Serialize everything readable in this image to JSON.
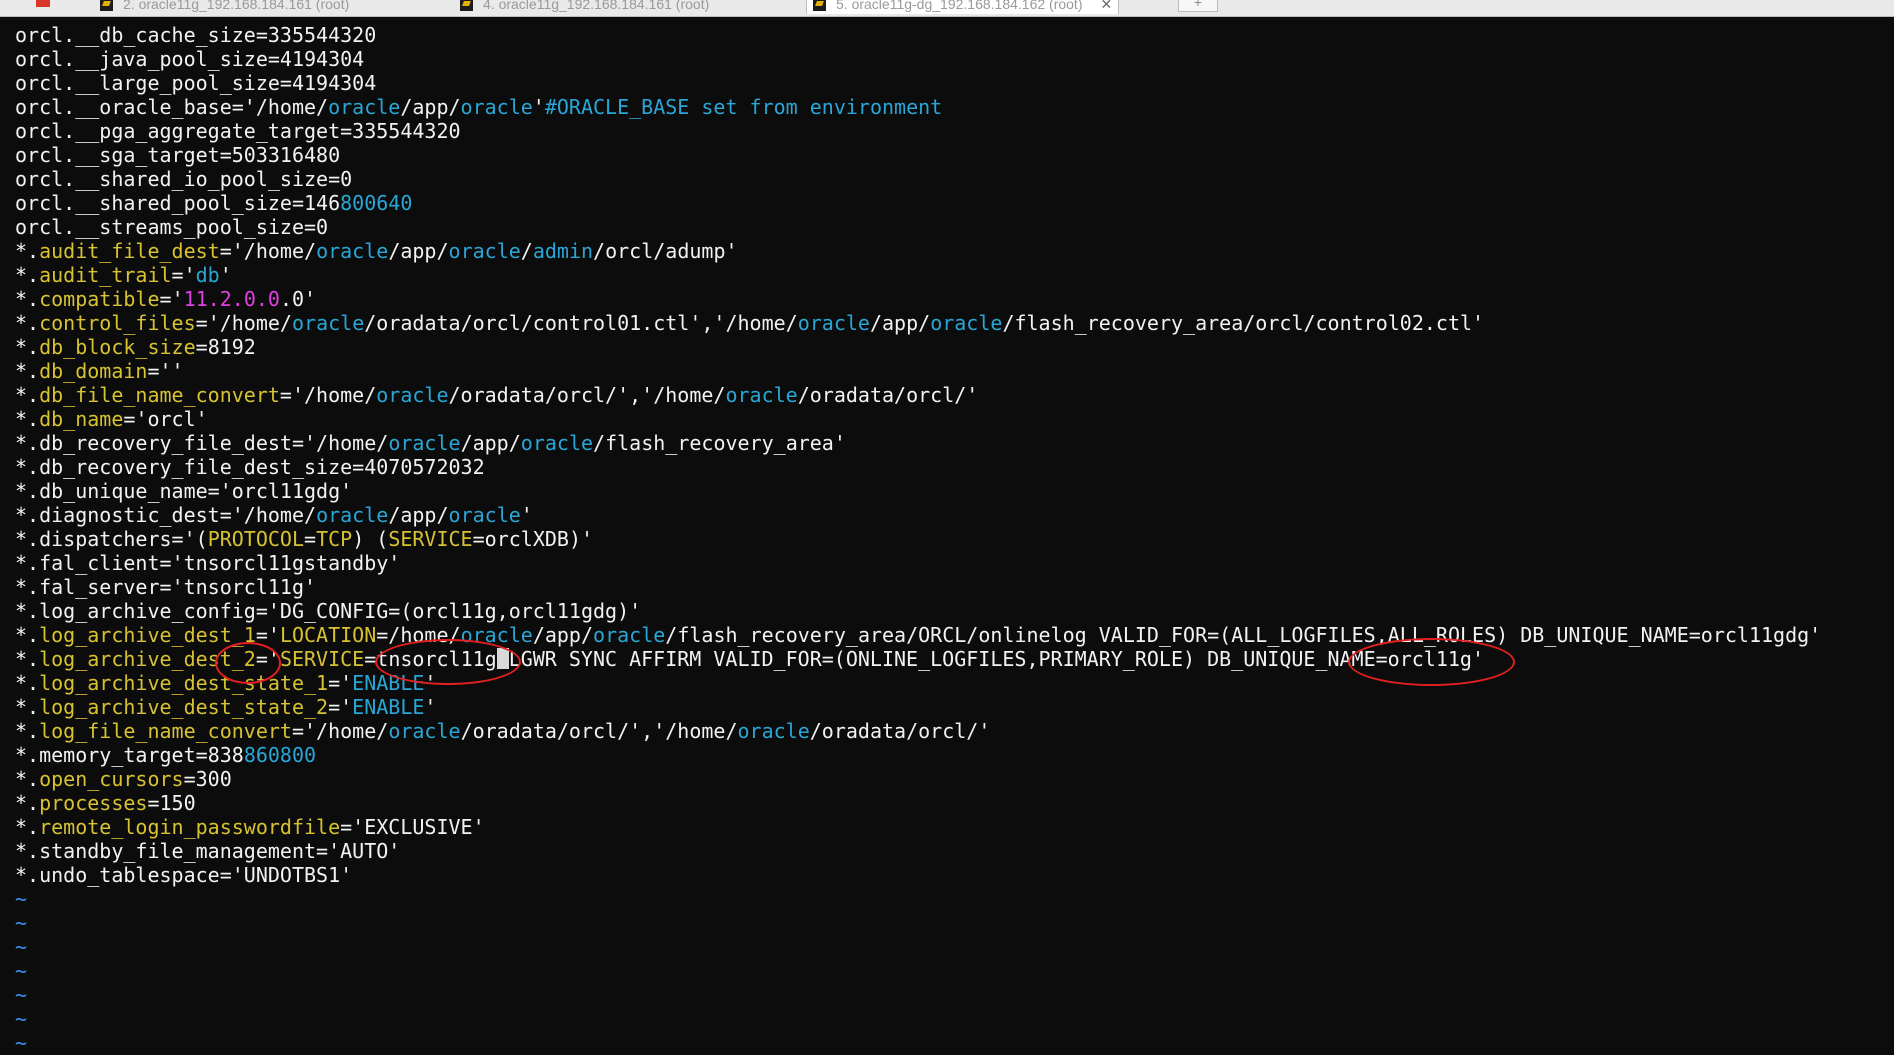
{
  "tabs": [
    {
      "label": "2. oracle11g_192.168.184.161 (root)"
    },
    {
      "label": "4. oracle11g_192.168.184.161 (root)"
    },
    {
      "label": "5. oracle11g-dg_192.168.184.162 (root)"
    }
  ],
  "tab_close": "✕",
  "new_tab": "+",
  "editor": {
    "lines": [
      "orcl.__db_cache_size=335544320",
      "orcl.__java_pool_size=4194304",
      "orcl.__large_pool_size=4194304",
      "orcl.__oracle_base='/home/oracle/app/oracle'#ORACLE_BASE set from environment",
      "orcl.__pga_aggregate_target=335544320",
      "orcl.__sga_target=503316480",
      "orcl.__shared_io_pool_size=0",
      "orcl.__shared_pool_size=146800640",
      "orcl.__streams_pool_size=0",
      "*.audit_file_dest='/home/oracle/app/oracle/admin/orcl/adump'",
      "*.audit_trail='db'",
      "*.compatible='11.2.0.0.0'",
      "*.control_files='/home/oracle/oradata/orcl/control01.ctl','/home/oracle/app/oracle/flash_recovery_area/orcl/control02.ctl'",
      "*.db_block_size=8192",
      "*.db_domain=''",
      "*.db_file_name_convert='/home/oracle/oradata/orcl/','/home/oracle/oradata/orcl/'",
      "*.db_name='orcl'",
      "*.db_recovery_file_dest='/home/oracle/app/oracle/flash_recovery_area'",
      "*.db_recovery_file_dest_size=4070572032",
      "*.db_unique_name='orcl11gdg'",
      "*.diagnostic_dest='/home/oracle/app/oracle'",
      "*.dispatchers='(PROTOCOL=TCP) (SERVICE=orclXDB)'",
      "*.fal_client='tnsorcl11gstandby'",
      "*.fal_server='tnsorcl11g'",
      "*.log_archive_config='DG_CONFIG=(orcl11g,orcl11gdg)'",
      "*.log_archive_dest_1='LOCATION=/home/oracle/app/oracle/flash_recovery_area/ORCL/onlinelog VALID_FOR=(ALL_LOGFILES,ALL_ROLES) DB_UNIQUE_NAME=orcl11gdg'",
      "*.log_archive_dest_2='SERVICE=tnsorcl11g LGWR SYNC AFFIRM VALID_FOR=(ONLINE_LOGFILES,PRIMARY_ROLE) DB_UNIQUE_NAME=orcl11g'",
      "*.log_archive_dest_state_1='ENABLE'",
      "*.log_archive_dest_state_2='ENABLE'",
      "*.log_file_name_convert='/home/oracle/oradata/orcl/','/home/oracle/oradata/orcl/'",
      "*.memory_target=838860800",
      "*.open_cursors=300",
      "*.processes=150",
      "*.remote_login_passwordfile='EXCLUSIVE'",
      "*.standby_file_management='AUTO'",
      "*.undo_tablespace='UNDOTBS1'"
    ],
    "tilde_count": 7,
    "tilde": "~"
  },
  "colors": {
    "background": "#0c0c0c",
    "text": "#f2f2f2",
    "keyword": "#d7c232",
    "path_word": "#2aa6d6",
    "number": "#e040e0",
    "tilde": "#3b8eea",
    "annotation": "#e32020"
  }
}
